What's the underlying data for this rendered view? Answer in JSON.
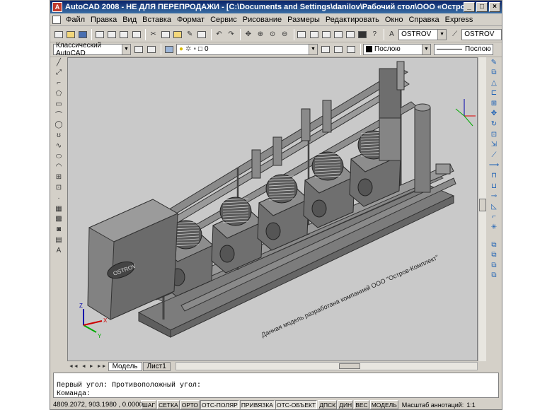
{
  "window": {
    "title": "AutoCAD 2008 - НЕ ДЛЯ ПЕРЕПРОДАЖИ - [C:\\Documents and Settings\\danilov\\Рабочий стол\\ООО «Остров-Комплект» Евдокимов Але...",
    "app_icon": "A",
    "minimize_symbol": "_",
    "maximize_symbol": "□",
    "close_symbol": "×"
  },
  "menu": [
    "Файл",
    "Правка",
    "Вид",
    "Вставка",
    "Формат",
    "Сервис",
    "Рисование",
    "Размеры",
    "Редактировать",
    "Окно",
    "Справка",
    "Express"
  ],
  "toolbar": {
    "text_style": "OSTROV",
    "dim_style": "OSTROV",
    "workspace": "Классический AutoCAD",
    "layer": "0",
    "color": "Послою",
    "linetype": "Послою"
  },
  "drawing": {
    "watermark": "Данная модель разработана компанией ООО \"Остров-Комплект\"",
    "panel_logo": "OSTROV",
    "ucs_x": "X",
    "ucs_y": "Y",
    "ucs_z": "Z"
  },
  "tabs": {
    "nav_first": "◄◄",
    "nav_prev": "◄",
    "nav_next": "►",
    "nav_last": "►►",
    "model": "Модель",
    "sheet1": "Лист1"
  },
  "command": {
    "line1": "",
    "line2": "Первый угол: Противоположный угол:",
    "line3": "Команда:"
  },
  "status": {
    "coords": "4809.2072, 903.1980 , 0.0000",
    "buttons": [
      "ШАГ",
      "СЕТКА",
      "ОРТО",
      "ОТС-ПОЛЯР",
      "ПРИВЯЗКА",
      "ОТС-ОБЪЕКТ",
      "ДПСК",
      "ДИН",
      "ВЕС",
      "МОДЕЛЬ"
    ],
    "annotation_scale_label": "Масштаб аннотаций:",
    "annotation_scale": "1:1"
  },
  "colors": {
    "titlebar": "#0a246a",
    "viewport_bg": "#c9c9c9",
    "model": "#6f6f6f"
  }
}
